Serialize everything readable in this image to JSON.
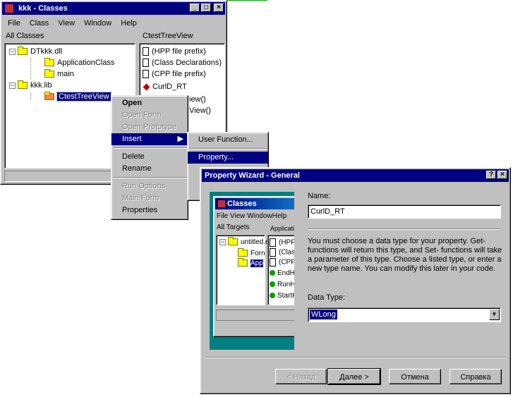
{
  "classes_window": {
    "title": "kkk - Classes",
    "menu": [
      "File",
      "Class",
      "View",
      "Window",
      "Help"
    ],
    "left_header": "All Classes",
    "right_header": "CtestTreeView",
    "tree": [
      "DTkkk.dll",
      "ApplicationClass",
      "main",
      "kkk.lib",
      "CtestTreeView"
    ],
    "members": [
      "(HPP file prefix)",
      "(Class Declarations)",
      "(CPP file prefix)",
      "CurlD_RT",
      "iew()",
      "View()"
    ]
  },
  "context_menu": {
    "items": [
      "Open",
      "Open Form",
      "Open Prototype",
      "Insert",
      "Delete",
      "Rename",
      "Run Options",
      "Main Form",
      "Properties"
    ]
  },
  "submenu": {
    "items": [
      "User Function...",
      "Property...",
      "",
      "",
      ""
    ]
  },
  "wizard": {
    "title": "Property Wizard - General",
    "name_label": "Name:",
    "name_value": "CurlD_RT",
    "description": "You must choose a data type for your property.  Get-functions will return this type, and Set- functions will take a parameter of this type.  Choose a listed type, or enter a new type name.  You can modify this later in your code.",
    "type_label": "Data Type:",
    "type_value": "WLong",
    "buttons": {
      "back": "< Назад",
      "next": "Далее >",
      "cancel": "Отмена",
      "help": "Справка"
    },
    "preview": {
      "title": "Classes",
      "menu": [
        "File",
        "View",
        "Window",
        "Help"
      ],
      "left_header": "All Targets",
      "right_header": "Applicatio",
      "tree": [
        "untitled.e",
        "Forn",
        "App"
      ],
      "members": [
        "(HPP",
        "(Class",
        "(CPP",
        "EndH",
        "RunH",
        "StartH"
      ]
    }
  }
}
